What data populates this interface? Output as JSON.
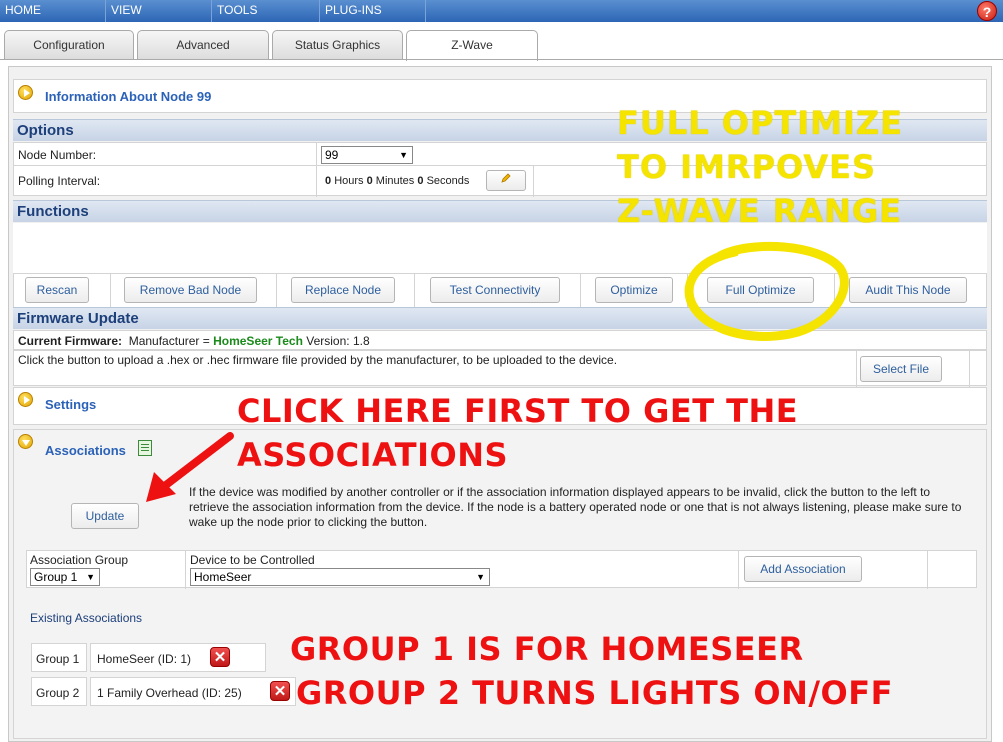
{
  "menu": {
    "items": [
      "HOME",
      "VIEW",
      "TOOLS",
      "PLUG-INS"
    ],
    "help": "?"
  },
  "tabs": [
    "Configuration",
    "Advanced",
    "Status Graphics",
    "Z-Wave"
  ],
  "info": {
    "title": "Information About Node 99"
  },
  "options": {
    "header": "Options",
    "node_number_label": "Node Number:",
    "node_number_value": "99",
    "polling_label": "Polling Interval:",
    "polling": {
      "hours": "0",
      "hours_unit": "Hours",
      "minutes": "0",
      "minutes_unit": "Minutes",
      "seconds": "0",
      "seconds_unit": "Seconds"
    }
  },
  "functions": {
    "header": "Functions",
    "buttons": [
      "Rescan",
      "Remove Bad Node",
      "Replace Node",
      "Test Connectivity",
      "Optimize",
      "Full Optimize",
      "Audit This Node"
    ]
  },
  "firmware": {
    "header": "Firmware Update",
    "current_label": "Current Firmware:",
    "manufacturer_prefix": "Manufacturer =",
    "manufacturer": "HomeSeer Tech",
    "version": "Version: 1.8",
    "instructions": "Click the button to upload a .hex or .hec firmware file provided by the manufacturer, to be uploaded to the device.",
    "select_file": "Select File"
  },
  "settings": {
    "title": "Settings"
  },
  "associations": {
    "title": "Associations",
    "update_button": "Update",
    "description": "If the device was modified by another controller or if the association information displayed appears to be invalid, click the button to the left to retrieve the association information from the device. If the node is a battery operated node or one that is not always listening, please make sure to wake up the node prior to clicking the button.",
    "group_label": "Association Group",
    "group_value": "Group 1",
    "device_label": "Device to be Controlled",
    "device_value": "HomeSeer",
    "add_button": "Add Association",
    "existing_label": "Existing Associations",
    "existing": [
      {
        "group": "Group 1",
        "device": "HomeSeer (ID: 1)"
      },
      {
        "group": "Group 2",
        "device": "1 Family Overhead (ID: 25)"
      }
    ]
  },
  "overlays": {
    "yellow": [
      "FULL OPTIMIZE",
      "TO IMRPOVES",
      "Z-WAVE RANGE"
    ],
    "red_top": [
      "CLICK HERE FIRST TO GET THE",
      "ASSOCIATIONS"
    ],
    "red_bottom": [
      "GROUP 1 IS FOR HOMESEER",
      "GROUP 2 TURNS LIGHTS ON/OFF"
    ]
  },
  "colors": {
    "accent": "#2b62b8",
    "menubar": "#2d66b5",
    "annotation_yellow": "#f5e300",
    "annotation_red": "#ee1111",
    "manufacturer_green": "#1a8a1a"
  }
}
